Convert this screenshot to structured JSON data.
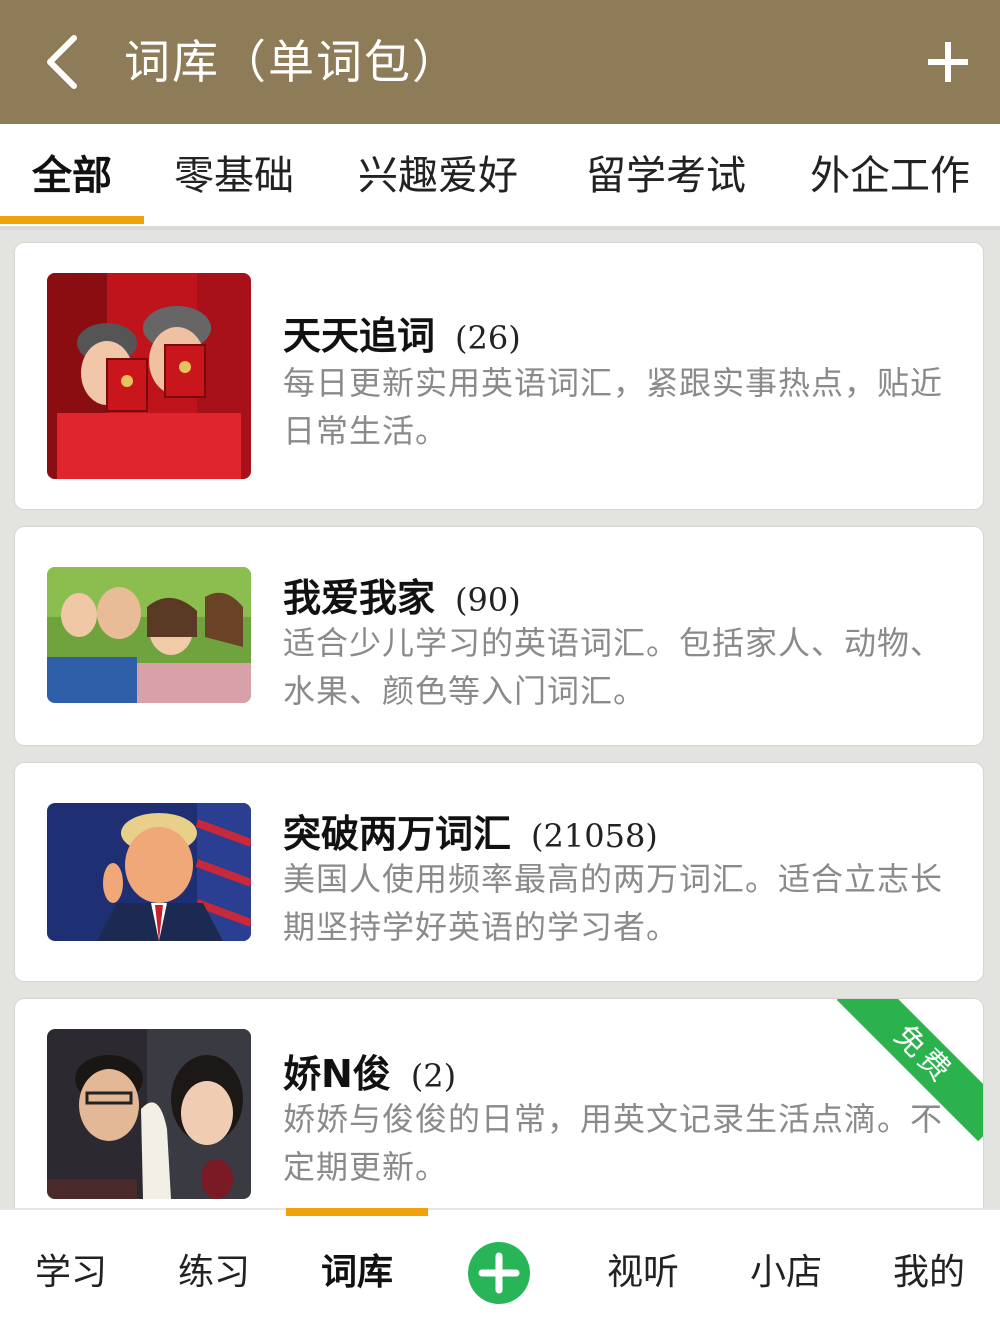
{
  "header": {
    "title": "词库（单词包）",
    "back_icon": "chevron-left-icon",
    "add_icon": "plus-icon"
  },
  "tabs": [
    {
      "label": "全部",
      "active": true
    },
    {
      "label": "零基础",
      "active": false
    },
    {
      "label": "兴趣爱好",
      "active": false
    },
    {
      "label": "留学考试",
      "active": false
    },
    {
      "label": "外企工作",
      "active": false
    }
  ],
  "packs": [
    {
      "title": "天天追词",
      "count": "(26)",
      "description": "每日更新实用英语词汇，紧跟实事热点，贴近日常生活。"
    },
    {
      "title": "我爱我家",
      "count": "(90)",
      "description": "适合少儿学习的英语词汇。包括家人、动物、水果、颜色等入门词汇。"
    },
    {
      "title": "突破两万词汇",
      "count": "(21058)",
      "description": "美国人使用频率最高的两万词汇。适合立志长期坚持学好英语的学习者。"
    },
    {
      "title": "娇N俊",
      "count": "(2)",
      "description": "娇娇与俊俊的日常，用英文记录生活点滴。不定期更新。",
      "badge": "免费"
    }
  ],
  "bottom_nav": {
    "items": [
      {
        "label": "学习",
        "active": false
      },
      {
        "label": "练习",
        "active": false
      },
      {
        "label": "词库",
        "active": true
      },
      {
        "label": "视听",
        "active": false
      },
      {
        "label": "小店",
        "active": false
      },
      {
        "label": "我的",
        "active": false
      }
    ],
    "center_icon": "plus-circle-icon"
  },
  "colors": {
    "header_bg": "#8e7b58",
    "accent": "#f1a20a",
    "badge_green": "#2bb24c",
    "nav_add_green": "#27b558"
  }
}
